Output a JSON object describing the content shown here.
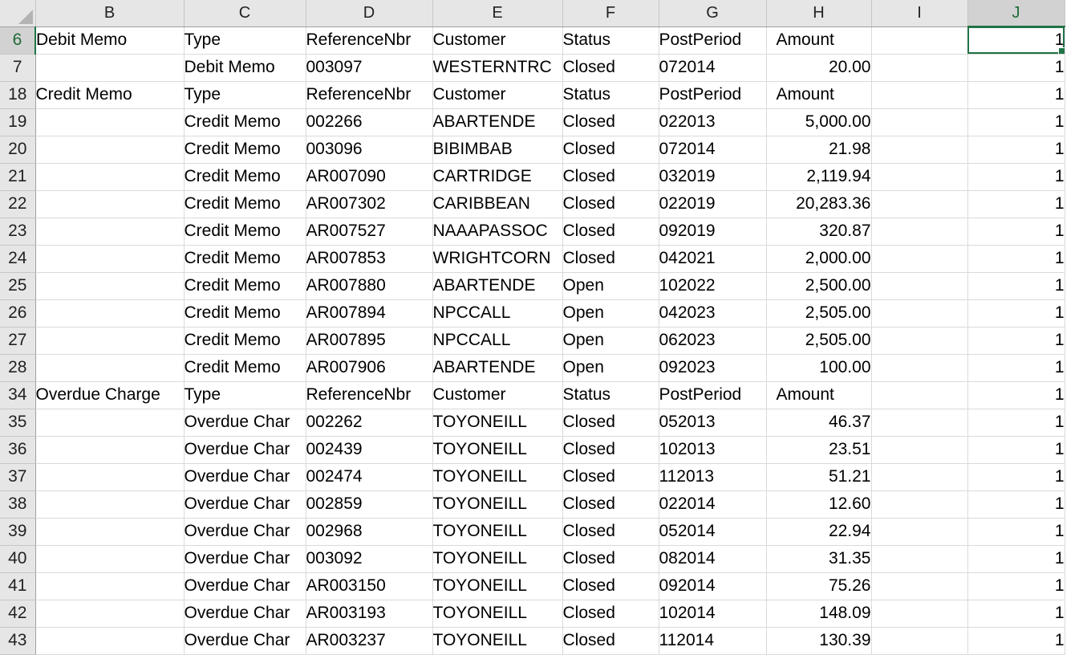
{
  "columns": [
    "B",
    "C",
    "D",
    "E",
    "F",
    "G",
    "H",
    "I",
    "J"
  ],
  "selected_column": "J",
  "selected_row": "6",
  "rows": [
    {
      "row": "6",
      "b": "Debit Memo",
      "c": "Type",
      "d": "ReferenceNbr",
      "e": "Customer",
      "f": "Status",
      "g": "PostPeriod",
      "h": "Amount",
      "i": "",
      "j": "1"
    },
    {
      "row": "7",
      "b": "",
      "c": "Debit Memo",
      "d": "003097",
      "e": "WESTERNTRC",
      "f": "Closed",
      "g": "072014",
      "h": "20.00",
      "i": "",
      "j": "1"
    },
    {
      "row": "18",
      "b": "Credit Memo",
      "c": "Type",
      "d": "ReferenceNbr",
      "e": "Customer",
      "f": "Status",
      "g": "PostPeriod",
      "h": "Amount",
      "i": "",
      "j": "1"
    },
    {
      "row": "19",
      "b": "",
      "c": "Credit Memo",
      "d": "002266",
      "e": "ABARTENDE",
      "f": "Closed",
      "g": "022013",
      "h": "5,000.00",
      "i": "",
      "j": "1"
    },
    {
      "row": "20",
      "b": "",
      "c": "Credit Memo",
      "d": "003096",
      "e": "BIBIMBAB",
      "f": "Closed",
      "g": "072014",
      "h": "21.98",
      "i": "",
      "j": "1"
    },
    {
      "row": "21",
      "b": "",
      "c": "Credit Memo",
      "d": "AR007090",
      "e": "CARTRIDGE",
      "f": "Closed",
      "g": "032019",
      "h": "2,119.94",
      "i": "",
      "j": "1"
    },
    {
      "row": "22",
      "b": "",
      "c": "Credit Memo",
      "d": "AR007302",
      "e": "CARIBBEAN",
      "f": "Closed",
      "g": "022019",
      "h": "20,283.36",
      "i": "",
      "j": "1"
    },
    {
      "row": "23",
      "b": "",
      "c": "Credit Memo",
      "d": "AR007527",
      "e": "NAAAPASSOC",
      "f": "Closed",
      "g": "092019",
      "h": "320.87",
      "i": "",
      "j": "1"
    },
    {
      "row": "24",
      "b": "",
      "c": "Credit Memo",
      "d": "AR007853",
      "e": "WRIGHTCORN",
      "f": "Closed",
      "g": "042021",
      "h": "2,000.00",
      "i": "",
      "j": "1"
    },
    {
      "row": "25",
      "b": "",
      "c": "Credit Memo",
      "d": "AR007880",
      "e": "ABARTENDE",
      "f": "Open",
      "g": "102022",
      "h": "2,500.00",
      "i": "",
      "j": "1"
    },
    {
      "row": "26",
      "b": "",
      "c": "Credit Memo",
      "d": "AR007894",
      "e": "NPCCALL",
      "f": "Open",
      "g": "042023",
      "h": "2,505.00",
      "i": "",
      "j": "1"
    },
    {
      "row": "27",
      "b": "",
      "c": "Credit Memo",
      "d": "AR007895",
      "e": "NPCCALL",
      "f": "Open",
      "g": "062023",
      "h": "2,505.00",
      "i": "",
      "j": "1"
    },
    {
      "row": "28",
      "b": "",
      "c": "Credit Memo",
      "d": "AR007906",
      "e": "ABARTENDE",
      "f": "Open",
      "g": "092023",
      "h": "100.00",
      "i": "",
      "j": "1"
    },
    {
      "row": "34",
      "b": "Overdue Charge",
      "c": "Type",
      "d": "ReferenceNbr",
      "e": "Customer",
      "f": "Status",
      "g": "PostPeriod",
      "h": "Amount",
      "i": "",
      "j": "1"
    },
    {
      "row": "35",
      "b": "",
      "c": "Overdue Char",
      "d": "002262",
      "e": "TOYONEILL",
      "f": "Closed",
      "g": "052013",
      "h": "46.37",
      "i": "",
      "j": "1"
    },
    {
      "row": "36",
      "b": "",
      "c": "Overdue Char",
      "d": "002439",
      "e": "TOYONEILL",
      "f": "Closed",
      "g": "102013",
      "h": "23.51",
      "i": "",
      "j": "1"
    },
    {
      "row": "37",
      "b": "",
      "c": "Overdue Char",
      "d": "002474",
      "e": "TOYONEILL",
      "f": "Closed",
      "g": "112013",
      "h": "51.21",
      "i": "",
      "j": "1"
    },
    {
      "row": "38",
      "b": "",
      "c": "Overdue Char",
      "d": "002859",
      "e": "TOYONEILL",
      "f": "Closed",
      "g": "022014",
      "h": "12.60",
      "i": "",
      "j": "1"
    },
    {
      "row": "39",
      "b": "",
      "c": "Overdue Char",
      "d": "002968",
      "e": "TOYONEILL",
      "f": "Closed",
      "g": "052014",
      "h": "22.94",
      "i": "",
      "j": "1"
    },
    {
      "row": "40",
      "b": "",
      "c": "Overdue Char",
      "d": "003092",
      "e": "TOYONEILL",
      "f": "Closed",
      "g": "082014",
      "h": "31.35",
      "i": "",
      "j": "1"
    },
    {
      "row": "41",
      "b": "",
      "c": "Overdue Char",
      "d": "AR003150",
      "e": "TOYONEILL",
      "f": "Closed",
      "g": "092014",
      "h": "75.26",
      "i": "",
      "j": "1"
    },
    {
      "row": "42",
      "b": "",
      "c": "Overdue Char",
      "d": "AR003193",
      "e": "TOYONEILL",
      "f": "Closed",
      "g": "102014",
      "h": "148.09",
      "i": "",
      "j": "1"
    },
    {
      "row": "43",
      "b": "",
      "c": "Overdue Char",
      "d": "AR003237",
      "e": "TOYONEILL",
      "f": "Closed",
      "g": "112014",
      "h": "130.39",
      "i": "",
      "j": "1"
    }
  ]
}
